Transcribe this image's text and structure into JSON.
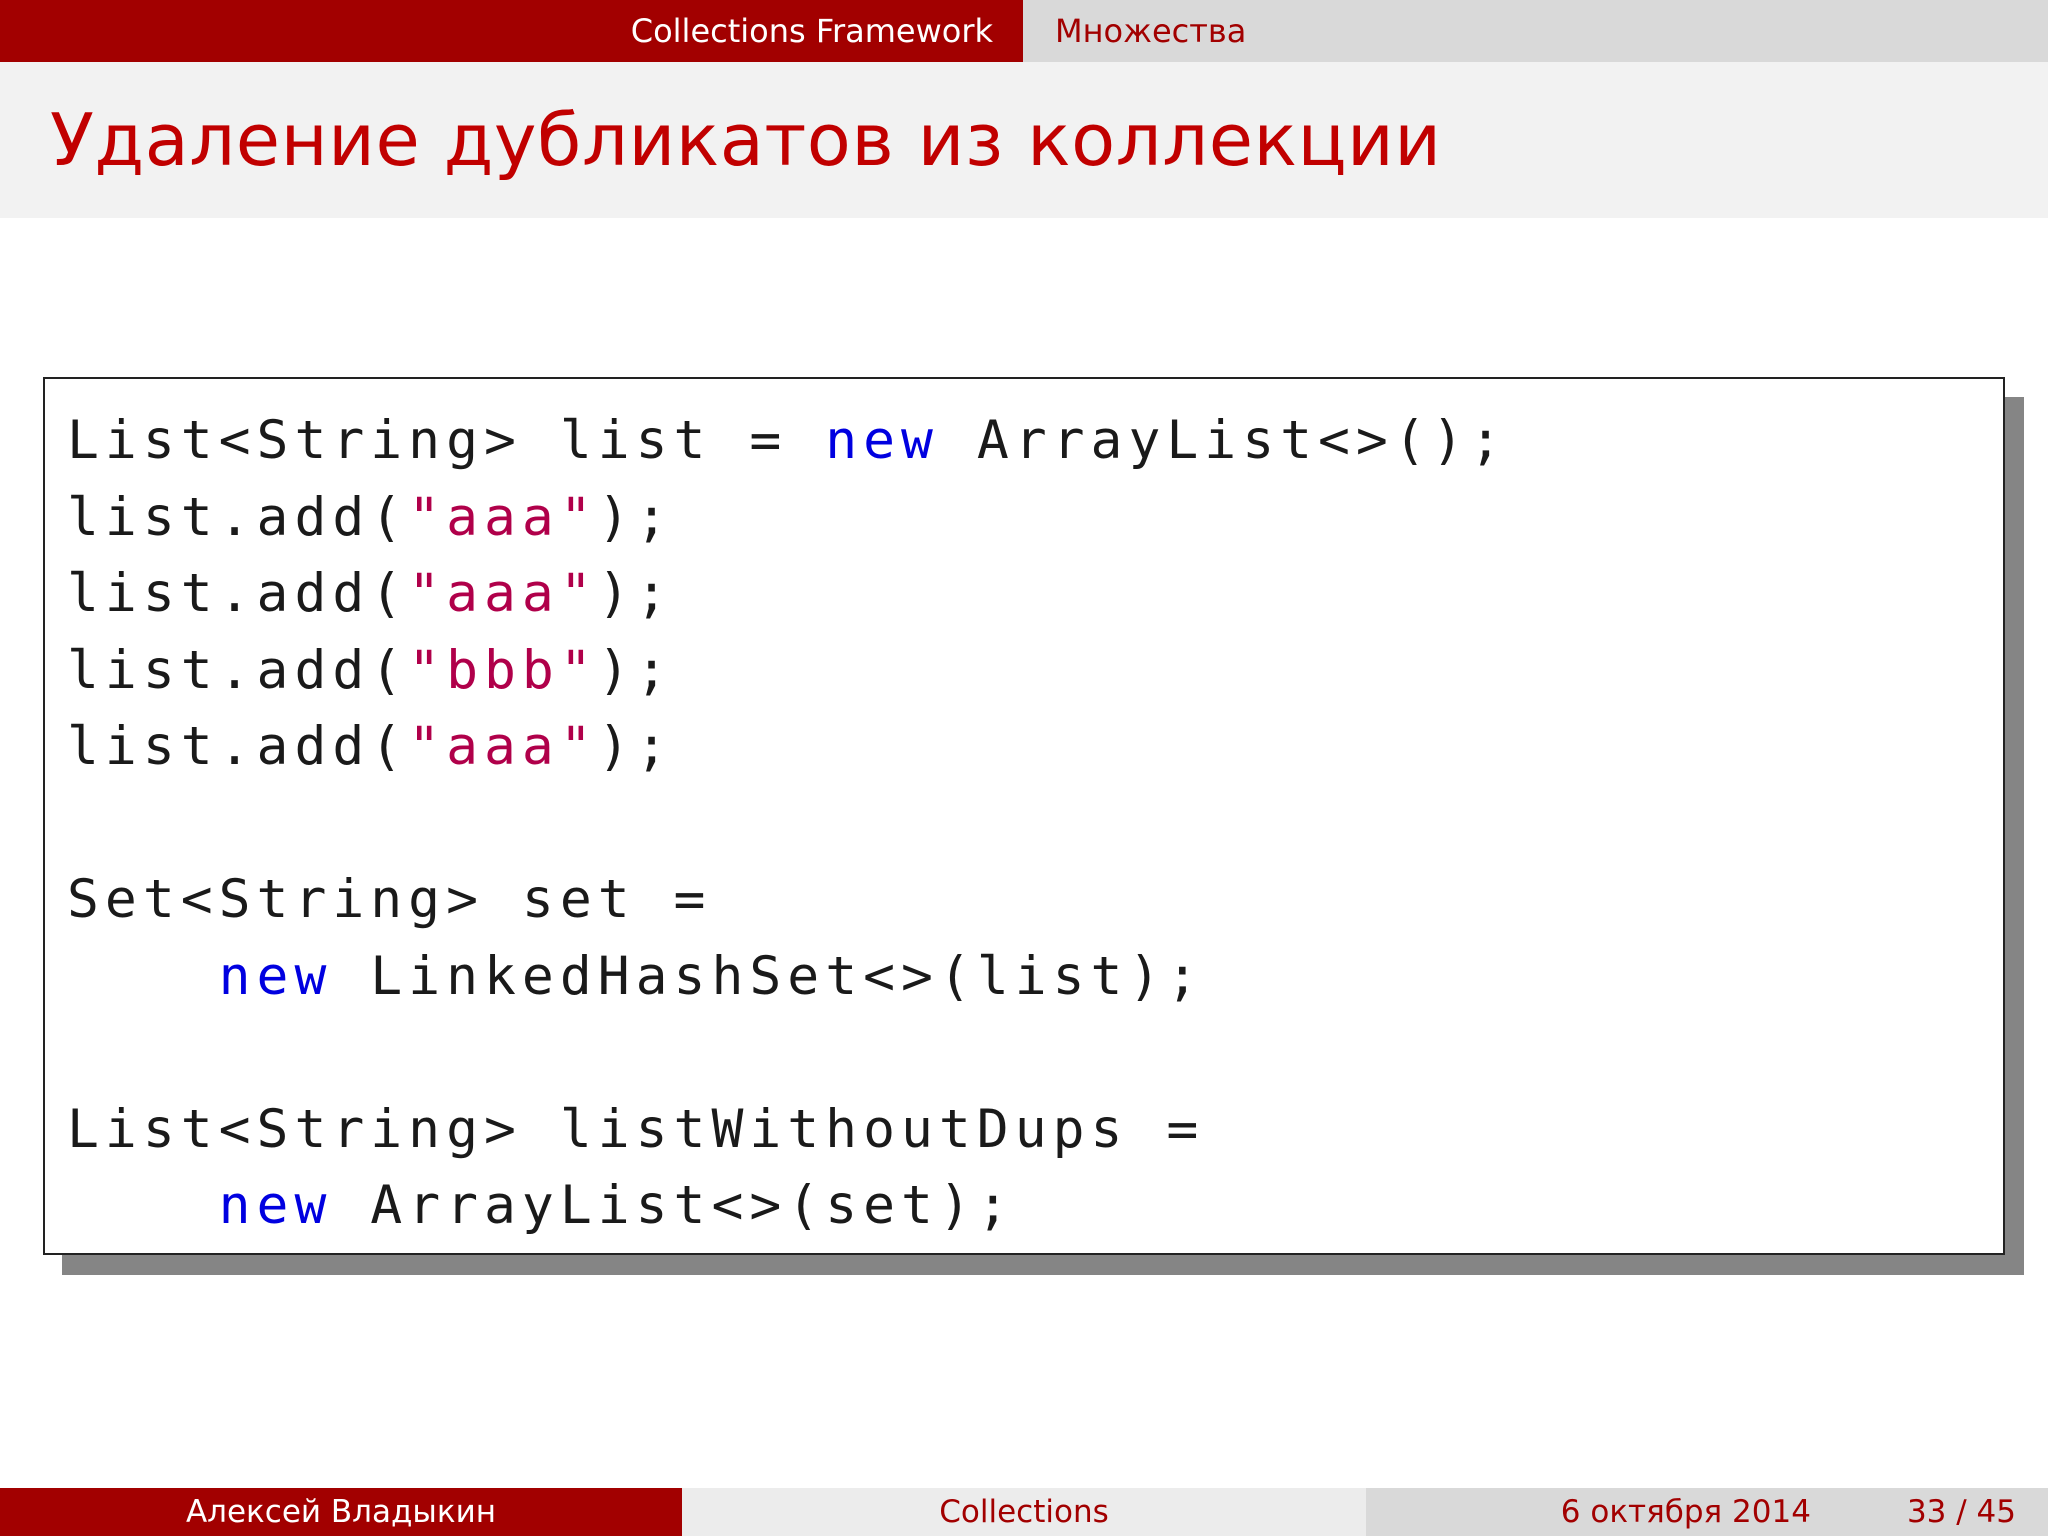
{
  "header": {
    "section": "Collections Framework",
    "subsection": "Множества"
  },
  "slide": {
    "title": "Удаление дубликатов из коллекции"
  },
  "code": {
    "lines": [
      [
        {
          "t": "List<String> list = ",
          "c": "plain"
        },
        {
          "t": "new",
          "c": "kw"
        },
        {
          "t": " ArrayList<>();",
          "c": "plain"
        }
      ],
      [
        {
          "t": "list.add(",
          "c": "plain"
        },
        {
          "t": "\"aaa\"",
          "c": "str"
        },
        {
          "t": ");",
          "c": "plain"
        }
      ],
      [
        {
          "t": "list.add(",
          "c": "plain"
        },
        {
          "t": "\"aaa\"",
          "c": "str"
        },
        {
          "t": ");",
          "c": "plain"
        }
      ],
      [
        {
          "t": "list.add(",
          "c": "plain"
        },
        {
          "t": "\"bbb\"",
          "c": "str"
        },
        {
          "t": ");",
          "c": "plain"
        }
      ],
      [
        {
          "t": "list.add(",
          "c": "plain"
        },
        {
          "t": "\"aaa\"",
          "c": "str"
        },
        {
          "t": ");",
          "c": "plain"
        }
      ],
      [],
      [
        {
          "t": "Set<String> set =",
          "c": "plain"
        }
      ],
      [
        {
          "t": "    ",
          "c": "plain"
        },
        {
          "t": "new",
          "c": "kw"
        },
        {
          "t": " LinkedHashSet<>(list);",
          "c": "plain"
        }
      ],
      [],
      [
        {
          "t": "List<String> listWithoutDups =",
          "c": "plain"
        }
      ],
      [
        {
          "t": "    ",
          "c": "plain"
        },
        {
          "t": "new",
          "c": "kw"
        },
        {
          "t": " ArrayList<>(set);",
          "c": "plain"
        }
      ]
    ],
    "colors": {
      "keyword": "#0000e0",
      "string": "#b0004a",
      "plain": "#1a1a1a"
    }
  },
  "footer": {
    "author": "Алексей Владыкин",
    "title": "Collections",
    "date": "6 октября 2014",
    "page": "33 / 45"
  },
  "theme": {
    "accent": "#a20000",
    "title_color": "#c10000"
  }
}
